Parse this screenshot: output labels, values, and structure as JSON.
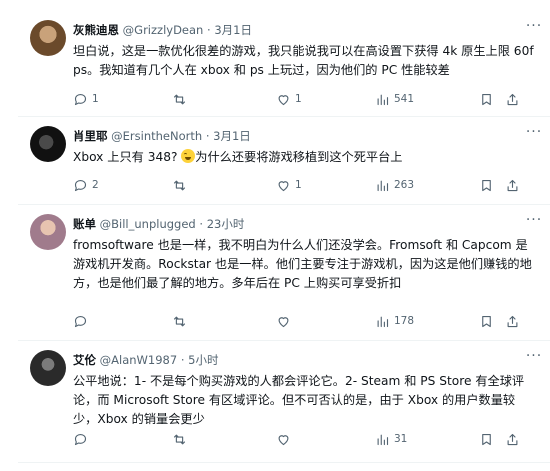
{
  "posts": [
    {
      "name": "灰熊迪恩",
      "handle": "@GrizzlyDean",
      "time": "3月1日",
      "text": "坦白说，这是一款优化很差的游戏，我只能说我可以在高设置下获得 4k 原生上限 60fps。我知道有几个人在 xbox 和 ps 上玩过，因为他们的 PC 性能较差",
      "replies": "1",
      "reposts": "",
      "likes": "1",
      "views": "541",
      "avatar_color": "#6b4a2b"
    },
    {
      "name": "肖里耶",
      "handle": "@ErsintheNorth",
      "time": "3月1日",
      "text_before": "Xbox 上只有 348? ",
      "text_after": "为什么还要将游戏移植到这个死平台上",
      "replies": "2",
      "reposts": "",
      "likes": "1",
      "views": "263",
      "avatar_color": "#1b1b1b"
    },
    {
      "name": "账单",
      "handle": "@Bill_unplugged",
      "time": "23小时",
      "text": "fromsoftware 也是一样，我不明白为什么人们还没学会。Fromsoft 和 Capcom 是游戏机开发商。Rockstar 也是一样。他们主要专注于游戏机，因为这是他们赚钱的地方，也是他们最了解的地方。多年后在 PC 上购买可享受折扣",
      "replies": "",
      "reposts": "",
      "likes": "",
      "views": "178",
      "avatar_color": "#a07b8c"
    },
    {
      "name": "艾伦",
      "handle": "@AlanW1987",
      "time": "5小时",
      "text": "公平地说：1- 不是每个购买游戏的人都会评论它。2- Steam 和 PS Store 有全球评论，而 Microsoft Store 有区域评论。但不可否认的是，由于 Xbox 的用户数量较少，Xbox 的销量会更少",
      "replies": "",
      "reposts": "",
      "likes": "",
      "views": "31",
      "avatar_color": "#2a2a2a"
    }
  ],
  "separator": "·",
  "more_label": "···"
}
